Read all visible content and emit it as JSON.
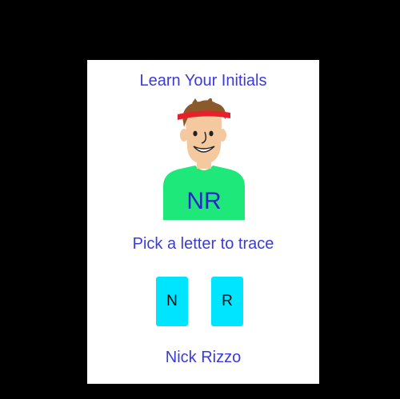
{
  "card": {
    "title": "Learn Your Initials",
    "avatar": {
      "icon": "boy-with-headband-icon",
      "initials": "NR",
      "shirt_color": "#1ee87a",
      "headband_color": "#e8202a"
    },
    "prompt": "Pick a letter to trace",
    "letters": [
      {
        "label": "N"
      },
      {
        "label": "R"
      }
    ],
    "button_color": "#00e5ff",
    "name": "Nick Rizzo"
  }
}
